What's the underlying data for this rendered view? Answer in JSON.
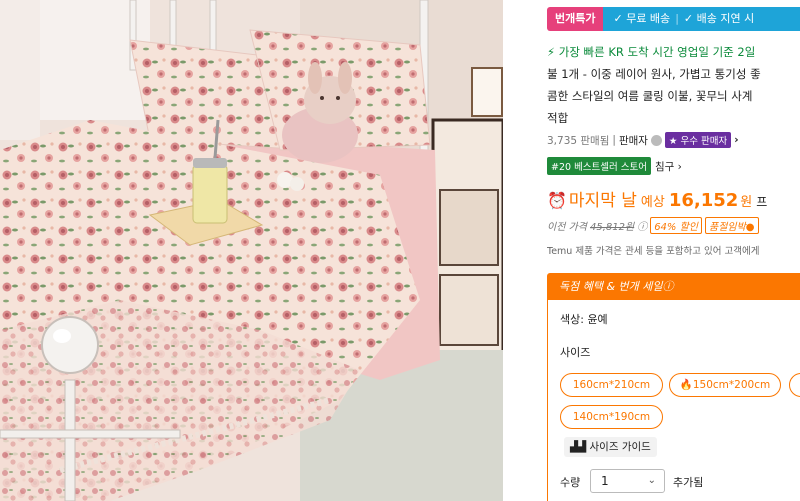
{
  "topbar": {
    "promo": "번개특가",
    "free_shipping": "✓ 무료 배송",
    "delay": "✓ 배송 지연 시"
  },
  "title": {
    "fast_icon": "lightning-icon",
    "line1_fast": "가장 빠른 KR 도착 시간 영업일 기준 2일",
    "line2": "불 1개 - 이중 레이어 원사, 가볍고 통기성 좋",
    "line3": "콤한 스타일의 여름 쿨링 이불, 꽃무늬 사계",
    "line4": "적합"
  },
  "meta": {
    "sold": "3,735 판매됨",
    "seller_label": "판매자",
    "star_badge": "★ 우수 판매자",
    "chevron": "›"
  },
  "rank": {
    "badge": "#20 베스트셀러 스토어",
    "category": "침구 ›"
  },
  "price": {
    "clock_icon": "⏰",
    "last_day": "마지막 날",
    "expected": "예상",
    "amount": "16,152",
    "won": "원",
    "suffix": "프"
  },
  "previous": {
    "label": "이전 가격",
    "value": "45,812원",
    "info_icon": "ⓘ",
    "discount": "64% 할인",
    "soon_soldout": "품절임박●"
  },
  "notice": "Temu 제품 가격은 관세 등을 포함하고 있어 고객에게",
  "deal": {
    "header": "독점 혜택 & 번개 세일ⓘ",
    "color_label": "색상: 윤예",
    "size_label": "사이즈",
    "sizes": [
      "160cm*210cm",
      "🔥150cm*200cm",
      "140cm*190cm"
    ],
    "guide": "사이즈 가이드",
    "qty_label": "수량",
    "qty_value": "1",
    "qty_extra": "추가됨"
  },
  "colors": {
    "orange": "#fb7701",
    "pink": "#e6407b",
    "blue": "#1ea4d8",
    "green": "#1f8a3a",
    "purple": "#6a2ea0"
  }
}
